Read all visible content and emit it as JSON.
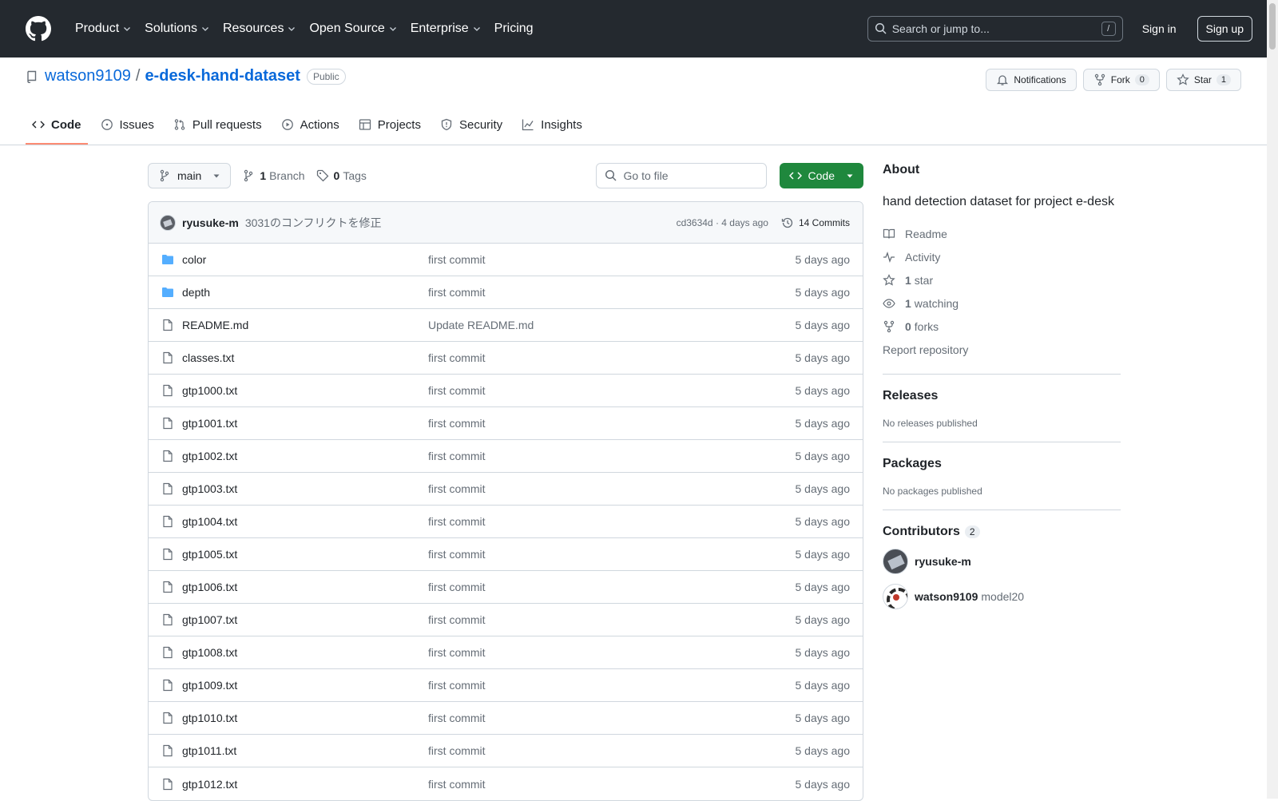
{
  "header": {
    "nav": [
      "Product",
      "Solutions",
      "Resources",
      "Open Source",
      "Enterprise",
      "Pricing"
    ],
    "search_placeholder": "Search or jump to...",
    "search_key": "/",
    "sign_in": "Sign in",
    "sign_up": "Sign up"
  },
  "repo": {
    "owner": "watson9109",
    "sep": "/",
    "name": "e-desk-hand-dataset",
    "visibility": "Public",
    "notifications": "Notifications",
    "fork_label": "Fork",
    "fork_count": "0",
    "star_label": "Star",
    "star_count": "1",
    "tabs": [
      "Code",
      "Issues",
      "Pull requests",
      "Actions",
      "Projects",
      "Security",
      "Insights"
    ]
  },
  "toolbar": {
    "branch": "main",
    "branch_count": "1",
    "branch_label": "Branch",
    "tag_count": "0",
    "tag_label": "Tags",
    "goto_placeholder": "Go to file",
    "code_label": "Code"
  },
  "commit": {
    "author": "ryusuke-m",
    "message": "3031のコンフリクトを修正",
    "hash_time": "cd3634d · 4 days ago",
    "commits": "14 Commits"
  },
  "files": [
    {
      "name": "color",
      "type": "dir",
      "commit": "first commit",
      "date": "5 days ago"
    },
    {
      "name": "depth",
      "type": "dir",
      "commit": "first commit",
      "date": "5 days ago"
    },
    {
      "name": "README.md",
      "type": "file",
      "commit": "Update README.md",
      "date": "5 days ago"
    },
    {
      "name": "classes.txt",
      "type": "file",
      "commit": "first commit",
      "date": "5 days ago"
    },
    {
      "name": "gtp1000.txt",
      "type": "file",
      "commit": "first commit",
      "date": "5 days ago"
    },
    {
      "name": "gtp1001.txt",
      "type": "file",
      "commit": "first commit",
      "date": "5 days ago"
    },
    {
      "name": "gtp1002.txt",
      "type": "file",
      "commit": "first commit",
      "date": "5 days ago"
    },
    {
      "name": "gtp1003.txt",
      "type": "file",
      "commit": "first commit",
      "date": "5 days ago"
    },
    {
      "name": "gtp1004.txt",
      "type": "file",
      "commit": "first commit",
      "date": "5 days ago"
    },
    {
      "name": "gtp1005.txt",
      "type": "file",
      "commit": "first commit",
      "date": "5 days ago"
    },
    {
      "name": "gtp1006.txt",
      "type": "file",
      "commit": "first commit",
      "date": "5 days ago"
    },
    {
      "name": "gtp1007.txt",
      "type": "file",
      "commit": "first commit",
      "date": "5 days ago"
    },
    {
      "name": "gtp1008.txt",
      "type": "file",
      "commit": "first commit",
      "date": "5 days ago"
    },
    {
      "name": "gtp1009.txt",
      "type": "file",
      "commit": "first commit",
      "date": "5 days ago"
    },
    {
      "name": "gtp1010.txt",
      "type": "file",
      "commit": "first commit",
      "date": "5 days ago"
    },
    {
      "name": "gtp1011.txt",
      "type": "file",
      "commit": "first commit",
      "date": "5 days ago"
    },
    {
      "name": "gtp1012.txt",
      "type": "file",
      "commit": "first commit",
      "date": "5 days ago"
    }
  ],
  "about": {
    "title": "About",
    "description": "hand detection dataset for project e-desk",
    "readme": "Readme",
    "activity": "Activity",
    "stars_n": "1",
    "stars_label": "star",
    "watching_n": "1",
    "watching_label": "watching",
    "forks_n": "0",
    "forks_label": "forks",
    "report": "Report repository"
  },
  "releases": {
    "title": "Releases",
    "note": "No releases published"
  },
  "packages": {
    "title": "Packages",
    "note": "No packages published"
  },
  "contributors": {
    "title": "Contributors",
    "count": "2",
    "list": [
      {
        "login": "ryusuke-m",
        "name": ""
      },
      {
        "login": "watson9109",
        "name": "model20"
      }
    ]
  },
  "colors": {
    "accent": "#0969da",
    "header_bg": "#24292f",
    "code_btn": "#1f883d",
    "tab_underline": "#fd8c73",
    "folder": "#54aeff"
  }
}
